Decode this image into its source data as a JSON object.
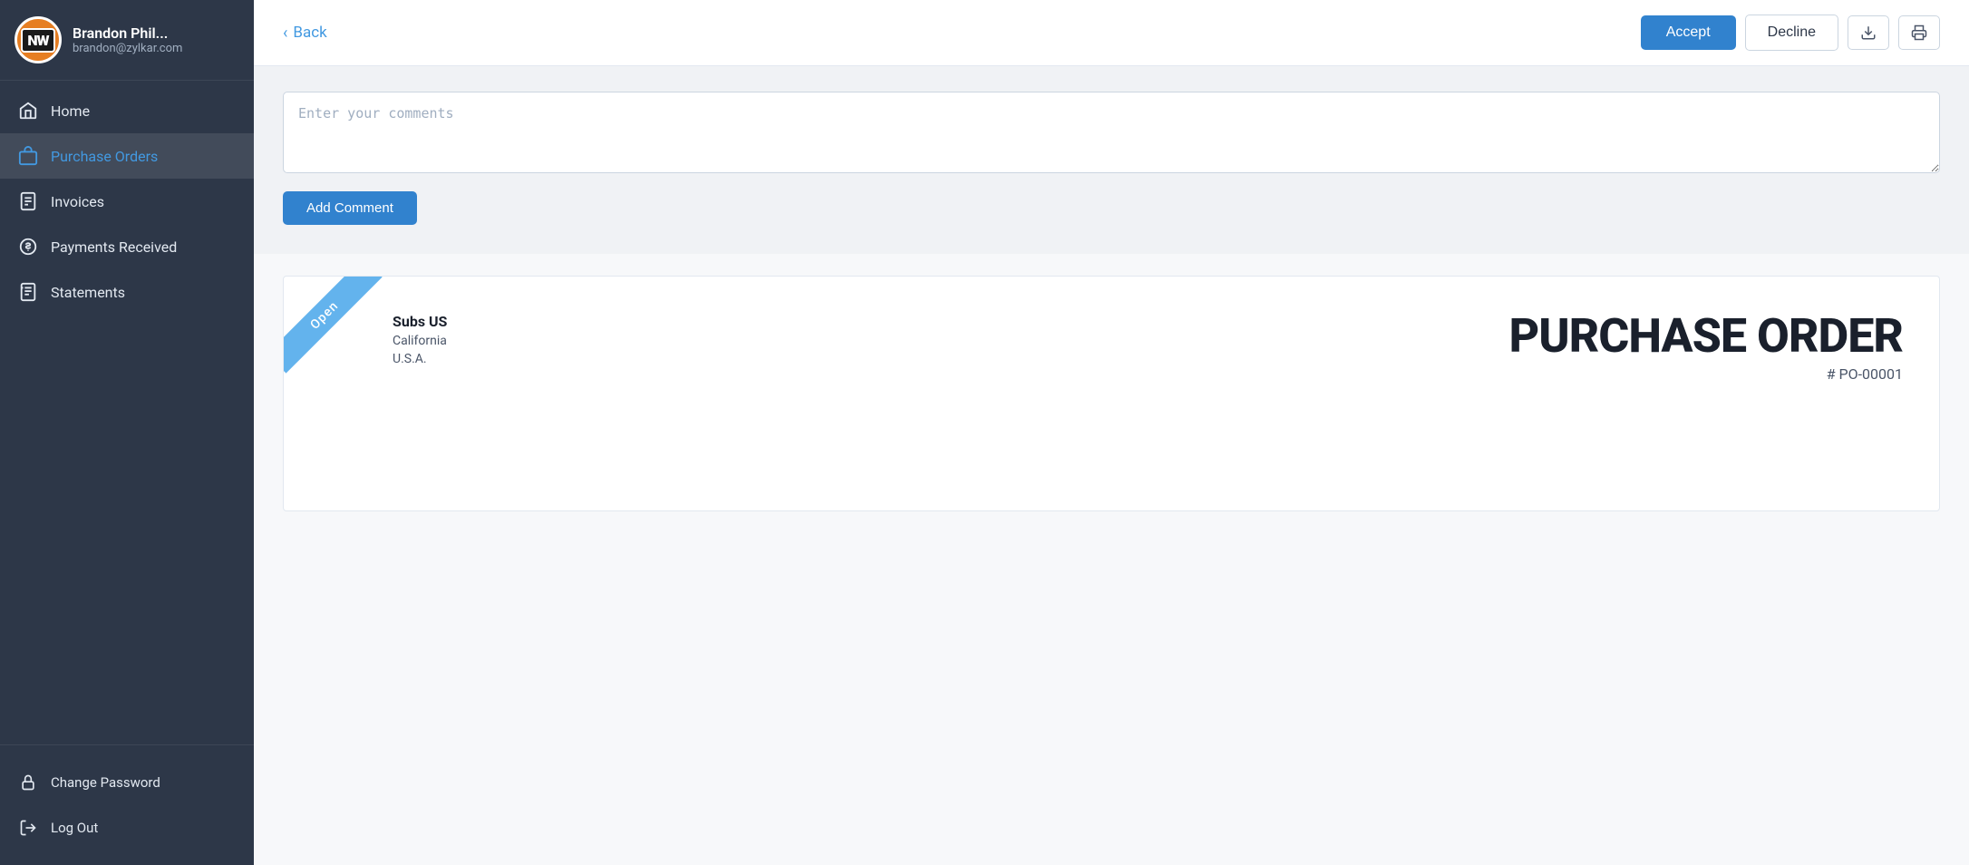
{
  "sidebar": {
    "logo_text": "NW",
    "user_name": "Brandon Phil...",
    "user_email": "brandon@zylkar.com",
    "nav_items": [
      {
        "id": "home",
        "label": "Home",
        "icon": "home-icon",
        "active": false
      },
      {
        "id": "purchase-orders",
        "label": "Purchase Orders",
        "icon": "bag-icon",
        "active": true
      },
      {
        "id": "invoices",
        "label": "Invoices",
        "icon": "invoice-icon",
        "active": false
      },
      {
        "id": "payments-received",
        "label": "Payments Received",
        "icon": "payment-icon",
        "active": false
      },
      {
        "id": "statements",
        "label": "Statements",
        "icon": "statement-icon",
        "active": false
      }
    ],
    "bottom_items": [
      {
        "id": "change-password",
        "label": "Change Password",
        "icon": "lock-icon"
      },
      {
        "id": "log-out",
        "label": "Log Out",
        "icon": "logout-icon"
      }
    ]
  },
  "header": {
    "back_label": "Back",
    "accept_label": "Accept",
    "decline_label": "Decline"
  },
  "comment_section": {
    "placeholder": "Enter your comments",
    "add_comment_label": "Add Comment"
  },
  "document": {
    "status_ribbon": "Open",
    "company_name": "Subs US",
    "address_line1": "California",
    "address_line2": "U.S.A.",
    "title": "PURCHASE ORDER",
    "po_number": "# PO-00001"
  }
}
